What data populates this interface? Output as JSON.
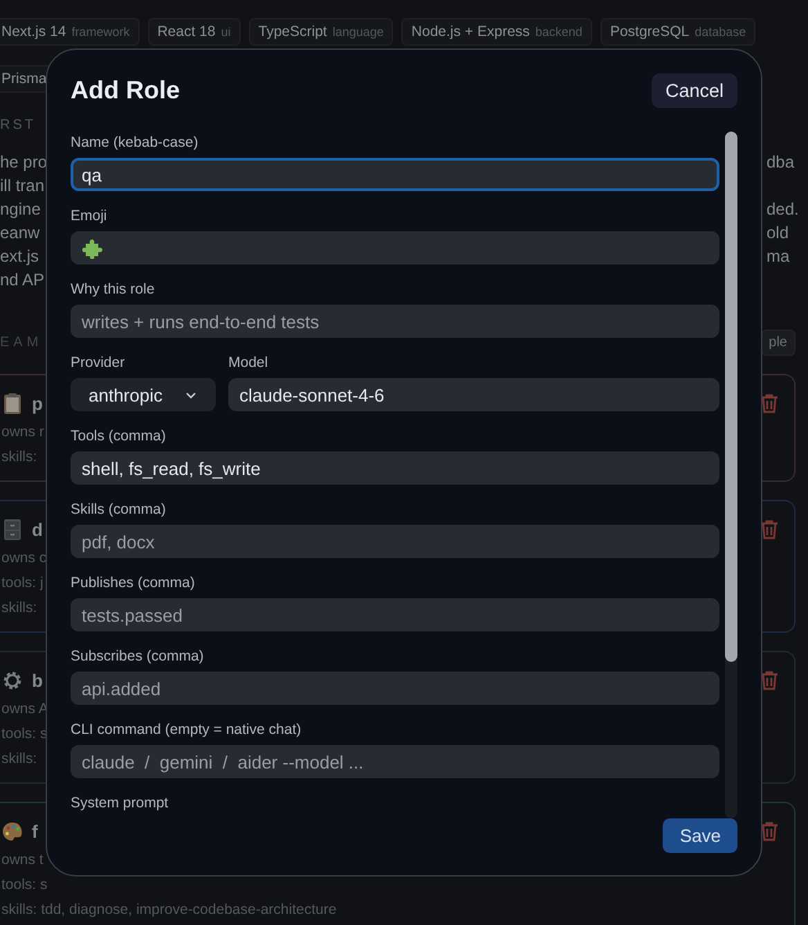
{
  "background": {
    "tech_tags": [
      {
        "name": "Next.js 14",
        "category": "framework"
      },
      {
        "name": "React 18",
        "category": "ui"
      },
      {
        "name": "TypeScript",
        "category": "language"
      },
      {
        "name": "Node.js + Express",
        "category": "backend"
      },
      {
        "name": "PostgreSQL",
        "category": "database"
      },
      {
        "name": "Prisma"
      }
    ],
    "section_heading": "RST",
    "intro_lines": [
      {
        "left": "he pro",
        "right": "dba"
      },
      {
        "left": "ill tran"
      },
      {
        "left": "ngine",
        "right": "ded."
      },
      {
        "left": "eanw",
        "right": "old"
      },
      {
        "left": "ext.js",
        "right": "ma"
      },
      {
        "left": "nd AP"
      }
    ],
    "team_heading": "EAM",
    "add_button": "ple",
    "team_cards": [
      {
        "name": "p",
        "color": "#3a2b2b",
        "lines": [
          "owns r",
          "skills:"
        ]
      },
      {
        "name": "d",
        "color": "#1f2b46",
        "lines": [
          "owns c",
          "tools: j",
          "skills:"
        ]
      },
      {
        "name": "b",
        "color": "#1f2c28",
        "lines": [
          "owns A",
          "tools: s",
          "skills:"
        ]
      },
      {
        "name": "f",
        "color": "#1d3a2e",
        "lines": [
          "owns t",
          "tools: s",
          "skills: tdd, diagnose, improve-codebase-architecture"
        ]
      }
    ]
  },
  "dialog": {
    "title": "Add Role",
    "cancel_button": "Cancel",
    "save_button": "Save",
    "fields": [
      {
        "kind": "input",
        "label": "Name (kebab-case)",
        "value": "qa",
        "focused": true
      },
      {
        "kind": "emoji",
        "label": "Emoji",
        "focused": false
      },
      {
        "kind": "input",
        "label": "Why this role",
        "placeholder": "writes + runs end-to-end tests",
        "focused": false
      },
      {
        "kind": "pair",
        "fields": [
          {
            "kind": "select",
            "label": "Provider",
            "value": "anthropic",
            "focused": false
          },
          {
            "kind": "input",
            "label": "Model",
            "value": "claude-sonnet-4-6",
            "focused": false
          }
        ]
      },
      {
        "kind": "input",
        "label": "Tools (comma)",
        "value": "shell, fs_read, fs_write",
        "focused": false
      },
      {
        "kind": "input",
        "label": "Skills (comma)",
        "placeholder": "pdf, docx",
        "focused": false
      },
      {
        "kind": "input",
        "label": "Publishes (comma)",
        "placeholder": "tests.passed",
        "focused": false
      },
      {
        "kind": "input",
        "label": "Subscribes (comma)",
        "placeholder": "api.added",
        "focused": false
      },
      {
        "kind": "input",
        "label": "CLI command (empty = native chat)",
        "placeholder": "claude  /  gemini  /  aider --model ...",
        "focused": false
      },
      {
        "kind": "textarea",
        "label": "System prompt"
      }
    ]
  }
}
